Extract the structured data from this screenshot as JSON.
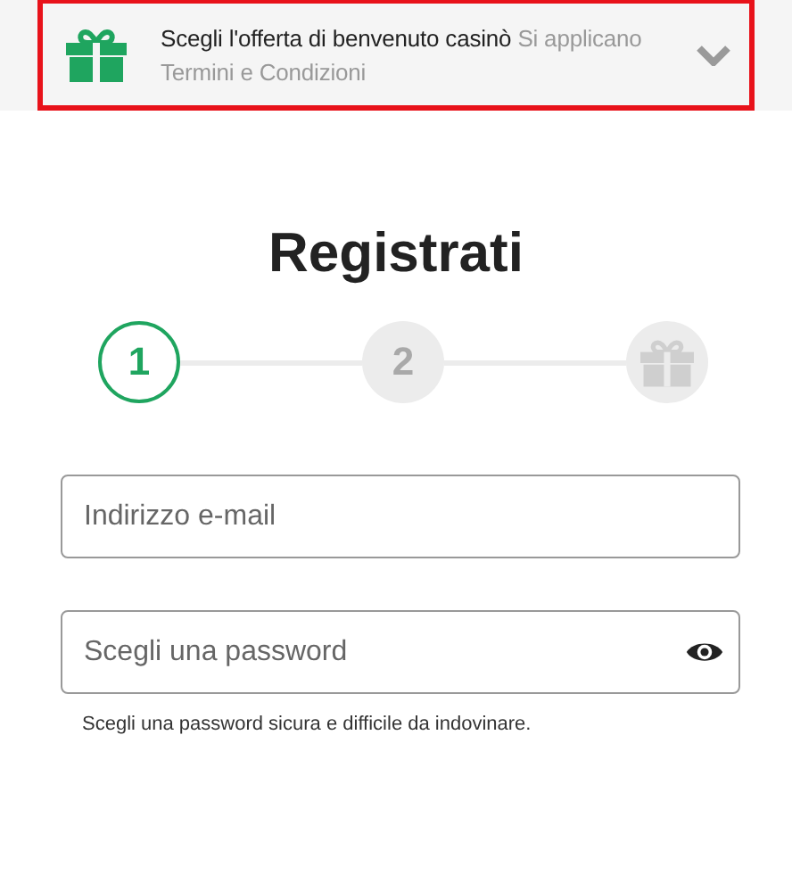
{
  "banner": {
    "title": "Scegli l'offerta di benvenuto casinò",
    "note": "Si applicano Termini e Condizioni",
    "expanded": false
  },
  "heading": "Registrati",
  "steps": [
    {
      "kind": "number",
      "label": "1",
      "selected": true
    },
    {
      "kind": "number",
      "label": "2",
      "selected": false
    },
    {
      "kind": "gift",
      "selected": false
    }
  ],
  "email": {
    "placeholder": "Indirizzo e-mail"
  },
  "password": {
    "placeholder": "Scegli una password",
    "hint": "Scegli una password sicura e difficile da indovinare."
  }
}
